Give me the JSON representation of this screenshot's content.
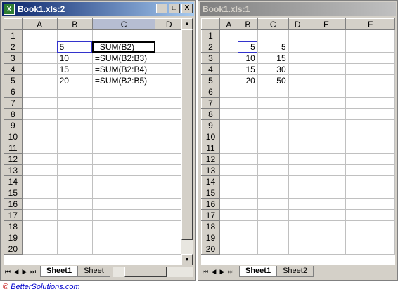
{
  "windows": {
    "left": {
      "title": "Book1.xls:2",
      "icon": "excel-icon",
      "col_headers": [
        "A",
        "B",
        "C",
        "D"
      ],
      "selected_col": "C",
      "row_headers": [
        "1",
        "2",
        "3",
        "4",
        "5",
        "6",
        "7",
        "8",
        "9",
        "10",
        "11",
        "12",
        "13",
        "14",
        "15",
        "16",
        "17",
        "18",
        "19",
        "20"
      ],
      "cells": {
        "B2": "5",
        "C2": "=SUM(B2)",
        "B3": "10",
        "C3": "=SUM(B2:B3)",
        "B4": "15",
        "C4": "=SUM(B2:B4)",
        "B5": "20",
        "C5": "=SUM(B2:B5)"
      },
      "tabs": [
        "Sheet1",
        "Sheet"
      ],
      "active_tab": "Sheet1",
      "buttons": {
        "minimize": "_",
        "restore": "□",
        "close": "X"
      }
    },
    "right": {
      "title": "Book1.xls:1",
      "col_headers": [
        "A",
        "B",
        "C",
        "D",
        "E",
        "F"
      ],
      "row_headers": [
        "1",
        "2",
        "3",
        "4",
        "5",
        "6",
        "7",
        "8",
        "9",
        "10",
        "11",
        "12",
        "13",
        "14",
        "15",
        "16",
        "17",
        "18",
        "19",
        "20"
      ],
      "cells": {
        "B2": "5",
        "C2": "5",
        "B3": "10",
        "C3": "15",
        "B4": "15",
        "C4": "30",
        "B5": "20",
        "C5": "50"
      },
      "tabs": [
        "Sheet1",
        "Sheet2"
      ],
      "active_tab": "Sheet1"
    }
  },
  "nav": {
    "first": "⏮",
    "prev": "◀",
    "next": "▶",
    "last": "⏭"
  },
  "footer": {
    "copyright": "©",
    "text": "BetterSolutions.com"
  },
  "colors": {
    "active_title": "#0a246a",
    "inactive_title": "#808080",
    "selected_header": "#b6bdd2"
  }
}
